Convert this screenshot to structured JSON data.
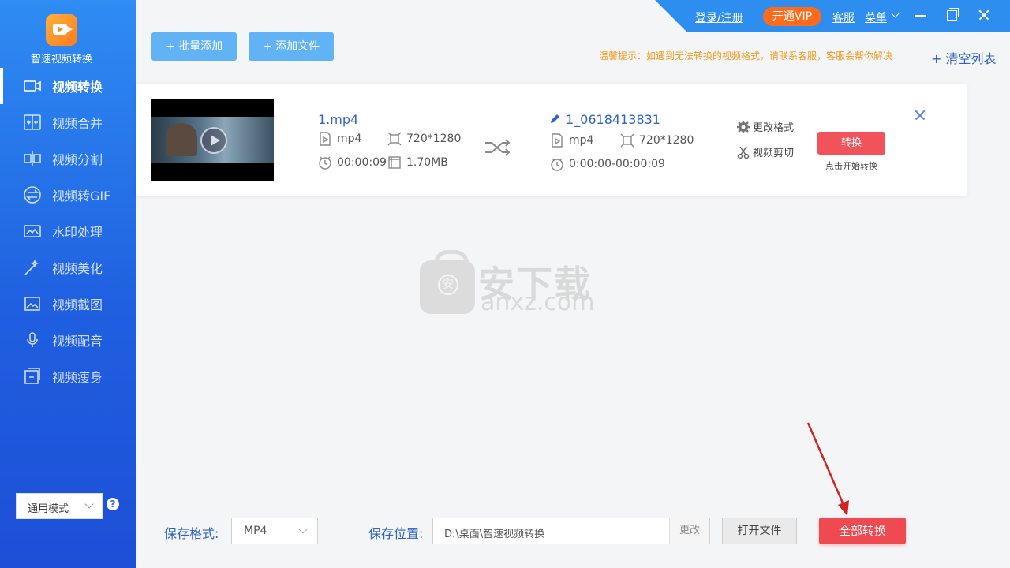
{
  "app": {
    "name": "智速视频转换"
  },
  "sidebar": {
    "items": [
      {
        "label": "视频转换",
        "icon": "video-camera-icon",
        "active": true
      },
      {
        "label": "视频合并",
        "icon": "merge-icon"
      },
      {
        "label": "视频分割",
        "icon": "split-icon"
      },
      {
        "label": "视频转GIF",
        "icon": "gif-convert-icon"
      },
      {
        "label": "水印处理",
        "icon": "watermark-icon"
      },
      {
        "label": "视频美化",
        "icon": "magic-wand-icon"
      },
      {
        "label": "视频截图",
        "icon": "image-icon"
      },
      {
        "label": "视频配音",
        "icon": "microphone-icon"
      },
      {
        "label": "视频瘦身",
        "icon": "compress-icon"
      }
    ],
    "mode": "通用模式",
    "help": "?"
  },
  "topbar": {
    "login": "登录/注册",
    "vip": "开通VIP",
    "service": "客服",
    "menu": "菜单"
  },
  "toolbar": {
    "batch_add": "+ 批量添加",
    "add_file": "+ 添加文件",
    "tip": "温馨提示：如遇到无法转换的视频格式，请联系客服，客服会帮你解决",
    "clear_list": "+ 清空列表"
  },
  "file": {
    "source_name": "1.mp4",
    "source_format": "mp4",
    "source_resolution": "720*1280",
    "source_duration": "00:00:09",
    "source_size": "1.70MB",
    "output_name": "1_0618413831",
    "output_format": "mp4",
    "output_resolution": "720*1280",
    "output_range": "0:00:00-00:00:09",
    "change_format": "更改格式",
    "video_cut": "视频剪切",
    "convert": "转换",
    "convert_hint": "点击开始转换"
  },
  "watermark": {
    "cn": "安下载",
    "en": "anxz.com",
    "badge": "安"
  },
  "bottom": {
    "format_label": "保存格式:",
    "format_value": "MP4",
    "location_label": "保存位置:",
    "location_value": "D:\\桌面\\智速视频转换",
    "change": "更改",
    "open_file": "打开文件",
    "convert_all": "全部转换"
  },
  "colors": {
    "accent": "#2f64c6",
    "danger": "#ef4a51",
    "vip": "#ff6b1a",
    "sidebar": "#1f5fe0"
  }
}
